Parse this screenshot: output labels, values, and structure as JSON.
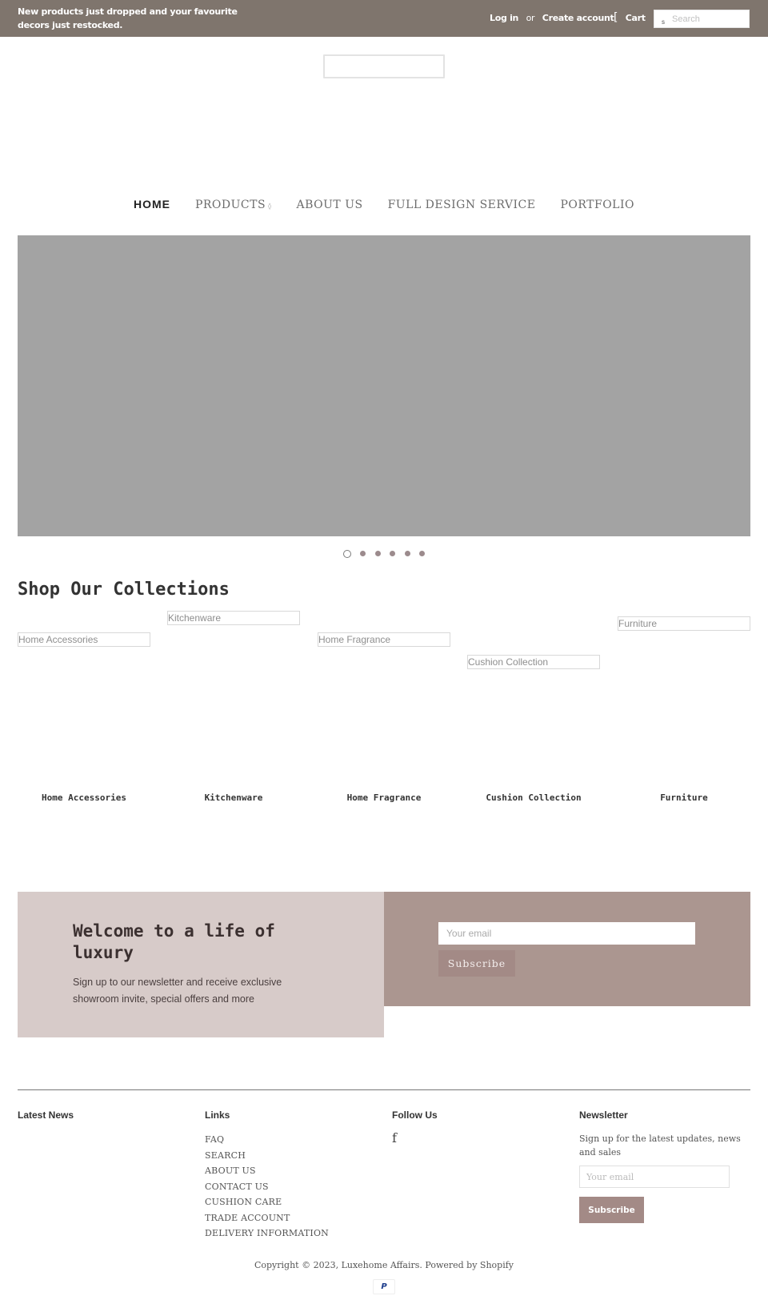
{
  "topbar": {
    "announcement": "New products just dropped and your favourite decors just restocked.",
    "login": "Log in",
    "or": "or",
    "create_account": "Create account",
    "cart_icon": "[",
    "cart": "Cart",
    "search_icon": "s",
    "search_placeholder": "Search"
  },
  "nav": {
    "items": [
      {
        "label": "HOME",
        "active": true
      },
      {
        "label": "PRODUCTS",
        "has_dropdown": true,
        "caret": "◊"
      },
      {
        "label": "ABOUT US"
      },
      {
        "label": "FULL DESIGN SERVICE"
      },
      {
        "label": "PORTFOLIO"
      }
    ]
  },
  "slideshow": {
    "slide_count": 6,
    "active_slide": 1
  },
  "collections": {
    "title": "Shop Our Collections",
    "items": [
      {
        "name": "Home Accessories",
        "image_alt": "Home Accessories"
      },
      {
        "name": "Kitchenware",
        "image_alt": "Kitchenware"
      },
      {
        "name": "Home Fragrance",
        "image_alt": "Home Fragrance"
      },
      {
        "name": "Cushion Collection",
        "image_alt": "Cushion Collection"
      },
      {
        "name": "Furniture",
        "image_alt": "Furniture"
      }
    ]
  },
  "newsletter_band": {
    "heading": "Welcome to a life of luxury",
    "text": "Sign up to our newsletter and receive exclusive showroom invite, special offers and more",
    "email_placeholder": "Your email",
    "button": "Subscribe"
  },
  "footer": {
    "latest_news": {
      "heading": "Latest News"
    },
    "links": {
      "heading": "Links",
      "items": [
        "FAQ",
        "SEARCH",
        "ABOUT US",
        "CONTACT US",
        "CUSHION CARE",
        "TRADE ACCOUNT",
        "DELIVERY INFORMATION"
      ]
    },
    "follow": {
      "heading": "Follow Us",
      "facebook_glyph": "f"
    },
    "newsletter": {
      "heading": "Newsletter",
      "text": "Sign up for the latest updates, news and sales",
      "email_placeholder": "Your email",
      "button": "Subscribe"
    },
    "copyright_prefix": "Copyright © 2023, ",
    "store_name": "Luxehome Affairs",
    "powered_by": "Powered by Shopify",
    "payment_icon": "P"
  },
  "colors": {
    "topbar_bg": "#7f756d",
    "slideshow_bg": "#a3a3a3",
    "welcome_bg": "#d7cbc9",
    "subscribe_panel_bg": "#ab9690",
    "button_bg": "#a38a86",
    "dot": "#9c8b8d"
  }
}
